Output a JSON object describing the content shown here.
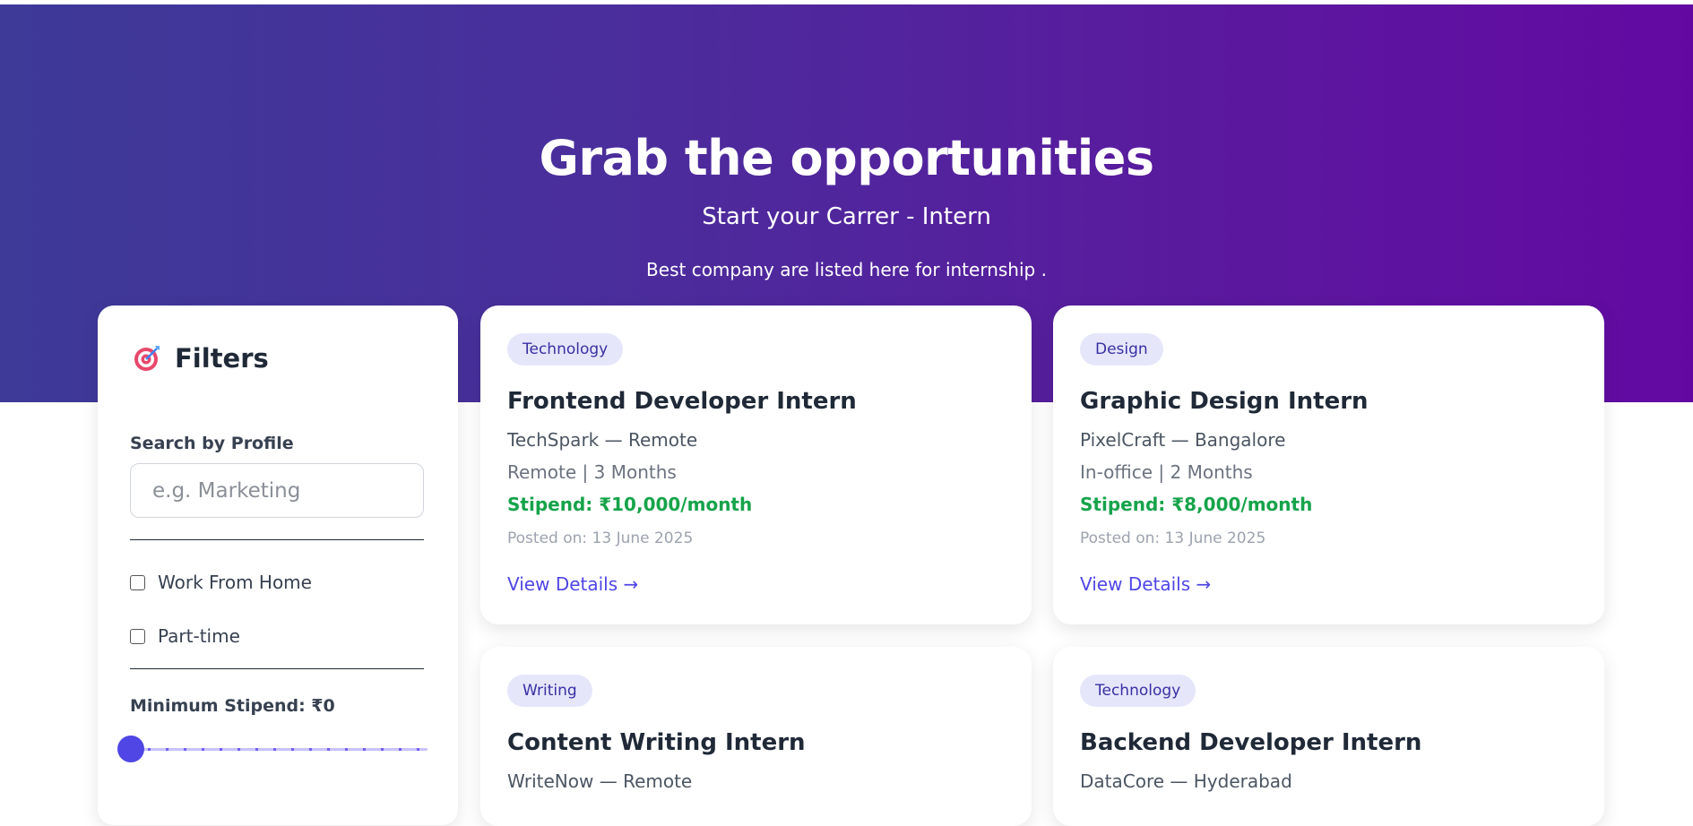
{
  "hero": {
    "title": "Grab the opportunities",
    "subtitle": "Start your Carrer - Intern",
    "description": "Best company are listed here for internship ."
  },
  "filters": {
    "title": "Filters",
    "icon": "target-icon",
    "search_label": "Search by Profile",
    "search_placeholder": "e.g. Marketing",
    "search_value": "",
    "checkboxes": [
      {
        "label": "Work From Home",
        "checked": false
      },
      {
        "label": "Part-time",
        "checked": false
      }
    ],
    "stipend_label": "Minimum Stipend: ₹0",
    "stipend_value": 0
  },
  "cards": [
    {
      "tag": "Technology",
      "title": "Frontend Developer Intern",
      "company": "TechSpark — Remote",
      "meta": "Remote | 3 Months",
      "stipend": "Stipend: ₹10,000/month",
      "posted": "Posted on: 13 June 2025",
      "link": "View Details →"
    },
    {
      "tag": "Design",
      "title": "Graphic Design Intern",
      "company": "PixelCraft — Bangalore",
      "meta": "In-office | 2 Months",
      "stipend": "Stipend: ₹8,000/month",
      "posted": "Posted on: 13 June 2025",
      "link": "View Details →"
    },
    {
      "tag": "Writing",
      "title": "Content Writing Intern",
      "company": "WriteNow — Remote"
    },
    {
      "tag": "Technology",
      "title": "Backend Developer Intern",
      "company": "DataCore — Hyderabad"
    }
  ],
  "colors": {
    "hero_start": "#3d3a98",
    "hero_end": "#6309a2",
    "accent": "#4f46e5",
    "stipend": "#16a34a",
    "tag_bg": "#e6e6fb"
  }
}
